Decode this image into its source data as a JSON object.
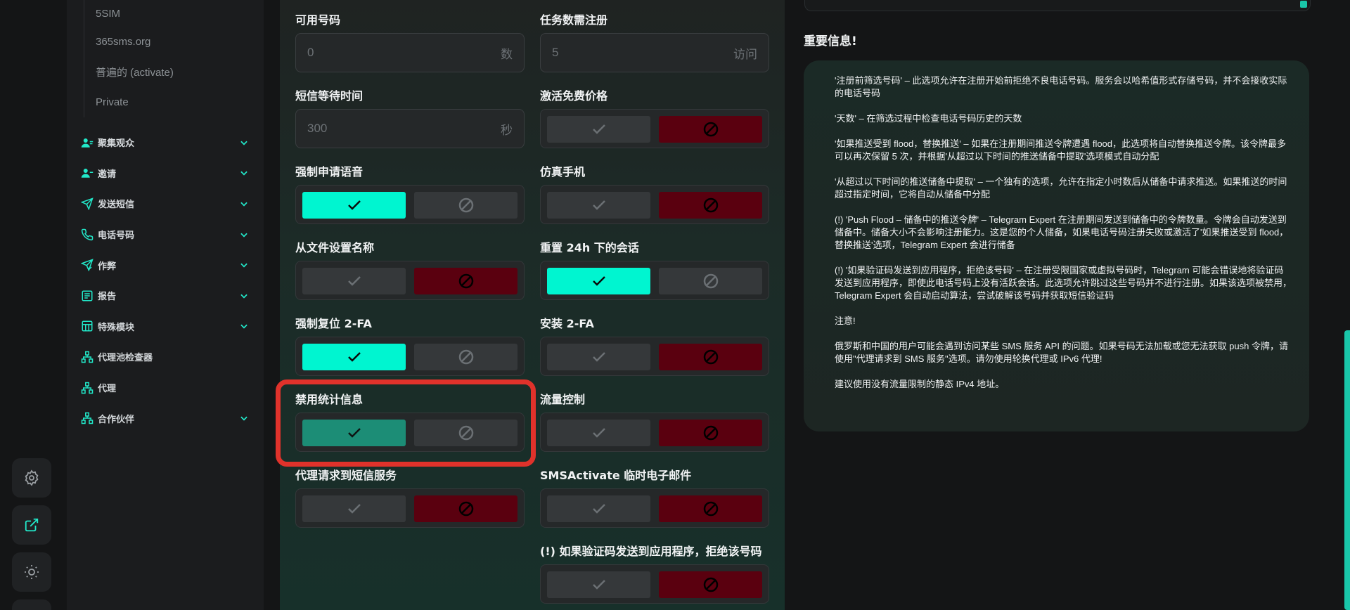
{
  "sidebar": {
    "sub_items": [
      "5SIM",
      "365sms.org",
      "普遍的 (activate)",
      "Private"
    ],
    "nav_items": [
      {
        "label": "聚集观众",
        "icon": "users-icon",
        "has_chevron": true
      },
      {
        "label": "邀请",
        "icon": "user-plus-icon",
        "has_chevron": true
      },
      {
        "label": "发送短信",
        "icon": "send-icon",
        "has_chevron": true
      },
      {
        "label": "电话号码",
        "icon": "phone-icon",
        "has_chevron": true
      },
      {
        "label": "作弊",
        "icon": "send-check-icon",
        "has_chevron": true
      },
      {
        "label": "报告",
        "icon": "report-icon",
        "has_chevron": true
      },
      {
        "label": "特殊模块",
        "icon": "grid-icon",
        "has_chevron": true
      },
      {
        "label": "代理池检查器",
        "icon": "network-icon",
        "has_chevron": false
      },
      {
        "label": "代理",
        "icon": "network-icon",
        "has_chevron": false
      },
      {
        "label": "合作伙伴",
        "icon": "network-icon",
        "has_chevron": true
      }
    ]
  },
  "rail": {
    "buttons": [
      "gear-icon",
      "external-link-icon",
      "sun-icon"
    ]
  },
  "form": {
    "available_numbers": {
      "label": "可用号码",
      "value": "0",
      "unit": "数"
    },
    "task_registrations": {
      "label": "任务数需注册",
      "value": "5",
      "unit": "访问"
    },
    "sms_wait_time": {
      "label": "短信等待时间",
      "value": "300",
      "unit": "秒"
    },
    "toggles": [
      {
        "key": "activation_free_price",
        "label": "激活免费价格",
        "state": "no"
      },
      {
        "key": "force_voice",
        "label": "强制申请语音",
        "state": "yes"
      },
      {
        "key": "emulate_phone",
        "label": "仿真手机",
        "state": "no"
      },
      {
        "key": "name_from_file",
        "label": "从文件设置名称",
        "state": "no"
      },
      {
        "key": "reset_sessions_24h",
        "label": "重置 24h 下的会话",
        "state": "yes"
      },
      {
        "key": "force_reset_2fa",
        "label": "强制复位 2-FA",
        "state": "yes"
      },
      {
        "key": "install_2fa",
        "label": "安装 2-FA",
        "state": "no"
      },
      {
        "key": "disable_stats",
        "label": "禁用统计信息",
        "state": "yes-dim"
      },
      {
        "key": "traffic_control",
        "label": "流量控制",
        "state": "no"
      },
      {
        "key": "proxy_sms_service",
        "label": "代理请求到短信服务",
        "state": "no"
      },
      {
        "key": "smsactivate_temp_email",
        "label": "SMSActivate 临时电子邮件",
        "state": "no"
      },
      {
        "key": "reject_code_to_app",
        "label": "(!) 如果验证码发送到应用程序，拒绝该号码",
        "state": "no"
      }
    ]
  },
  "info": {
    "title": "重要信息!",
    "paragraphs": [
      "'注册前筛选号码' – 此选项允许在注册开始前拒绝不良电话号码。服务会以哈希值形式存储号码，并不会接收实际的电话号码",
      "'天数' – 在筛选过程中检查电话号码历史的天数",
      "'如果推送受到 flood，替换推送' – 如果在注册期间推送令牌遭遇 flood，此选项将自动替换推送令牌。该令牌最多可以再次保留 5 次，并根据'从超过以下时间的推送储备中提取'选项模式自动分配",
      "'从超过以下时间的推送储备中提取' – 一个独有的选项，允许在指定小时数后从储备中请求推送。如果推送的时间超过指定时间，它将自动从储备中分配",
      "(!) 'Push Flood – 储备中的推送令牌' – Telegram Expert 在注册期间发送到储备中的令牌数量。令牌会自动发送到储备中。储备大小不会影响注册能力。这是您的个人储备，如果电话号码注册失败或激活了'如果推送受到 flood，替换推送'选项，Telegram Expert 会进行储备",
      "(!) '如果验证码发送到应用程序，拒绝该号码' – 在注册受限国家或虚拟号码时，Telegram 可能会错误地将验证码发送到应用程序，即使此电话号码上没有活跃会话。此选项允许跳过这些号码并不进行注册。如果该选项被禁用，Telegram Expert 会自动启动算法，尝试破解该号码并获取短信验证码",
      "注意!",
      "俄罗斯和中国的用户可能会遇到访问某些 SMS 服务 API 的问题。如果号码无法加载或您无法获取 push 令牌，请使用\"代理请求到 SMS 服务\"选项。请勿使用轮换代理或 IPv6 代理!",
      "建议使用没有流量限制的静态 IPv4 地址。"
    ]
  },
  "colors": {
    "accent": "#00f5d0",
    "deny": "#5a000f",
    "highlight": "#e0322b"
  }
}
